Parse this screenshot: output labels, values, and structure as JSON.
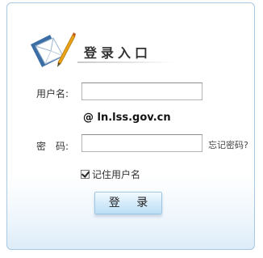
{
  "login_panel": {
    "title": "登录入口",
    "username_label": "用户名:",
    "username_value": "",
    "domain_suffix": "@ ln.lss.gov.cn",
    "password_label": "密　码:",
    "password_value": "",
    "forgot_password": "忘记密码?",
    "remember_label": "记住用户名",
    "remember_checked": true,
    "login_button": "登 录"
  },
  "colors": {
    "panel_border": "#a9c8e3",
    "button_top": "#f3faff",
    "button_bottom": "#bddff6",
    "envelope_blue": "#3b6ea5"
  },
  "icons": {
    "logo": "envelope-pen-icon"
  }
}
